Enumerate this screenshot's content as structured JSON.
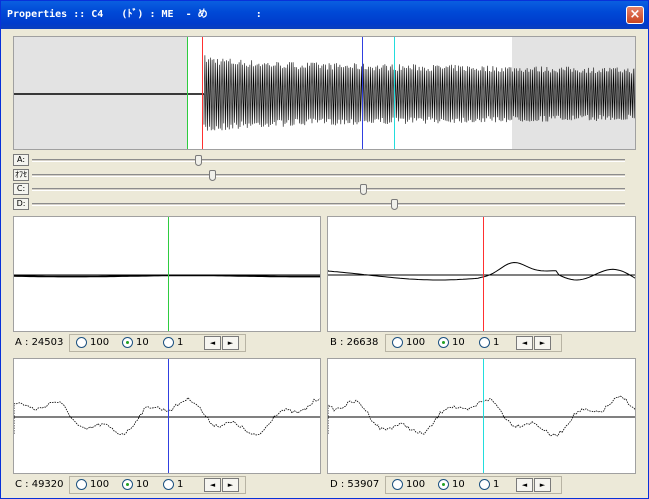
{
  "window": {
    "title": "Properties :: C4   (ﾄﾞ) : ME  - め        :",
    "close_label": "×"
  },
  "colors": {
    "marker_a": "#2ecc40",
    "marker_b": "#ff3030",
    "marker_c": "#3040e0",
    "marker_d": "#22dddd",
    "shade": "#e3e3e3"
  },
  "sliders": [
    {
      "label": "A:",
      "level": 0.28
    },
    {
      "label": "ｵﾌｾ",
      "level": 0.3
    },
    {
      "label": "C:",
      "level": 0.56
    },
    {
      "label": "D:",
      "level": 0.61
    }
  ],
  "zoom_panels": [
    {
      "status": "A : 24503",
      "options": [
        "100",
        "10",
        "1"
      ],
      "selected": "10",
      "prev_icon": "◄",
      "next_icon": "►"
    },
    {
      "status": "B : 26638",
      "options": [
        "100",
        "10",
        "1"
      ],
      "selected": "10",
      "prev_icon": "◄",
      "next_icon": "►"
    },
    {
      "status": "C : 49320",
      "options": [
        "100",
        "10",
        "1"
      ],
      "selected": "10",
      "prev_icon": "◄",
      "next_icon": "►"
    },
    {
      "status": "D : 53907",
      "options": [
        "100",
        "10",
        "1"
      ],
      "selected": "10",
      "prev_icon": "◄",
      "next_icon": "►"
    }
  ]
}
